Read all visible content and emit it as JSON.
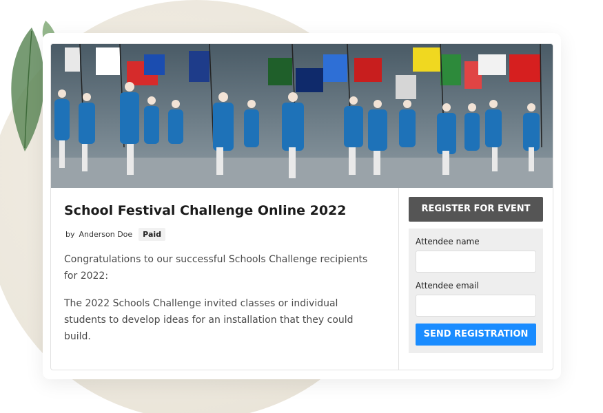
{
  "event": {
    "title": "School Festival Challenge Online 2022",
    "by_label": "by",
    "author": "Anderson Doe",
    "badge": "Paid",
    "paragraphs": [
      "Congratulations to our successful Schools Challenge recipients for 2022:",
      "The 2022 Schools Challenge invited classes or individual students to develop ideas for an installation that they could build."
    ],
    "hero_image": "parade-photo"
  },
  "registration": {
    "register_label": "REGISTER FOR EVENT",
    "name_label": "Attendee name",
    "name_value": "",
    "email_label": "Attendee email",
    "email_value": "",
    "send_label": "SEND REGISTRATION"
  },
  "colors": {
    "register_button": "#555555",
    "send_button": "#1a8cff",
    "form_background": "#eeeeee"
  }
}
